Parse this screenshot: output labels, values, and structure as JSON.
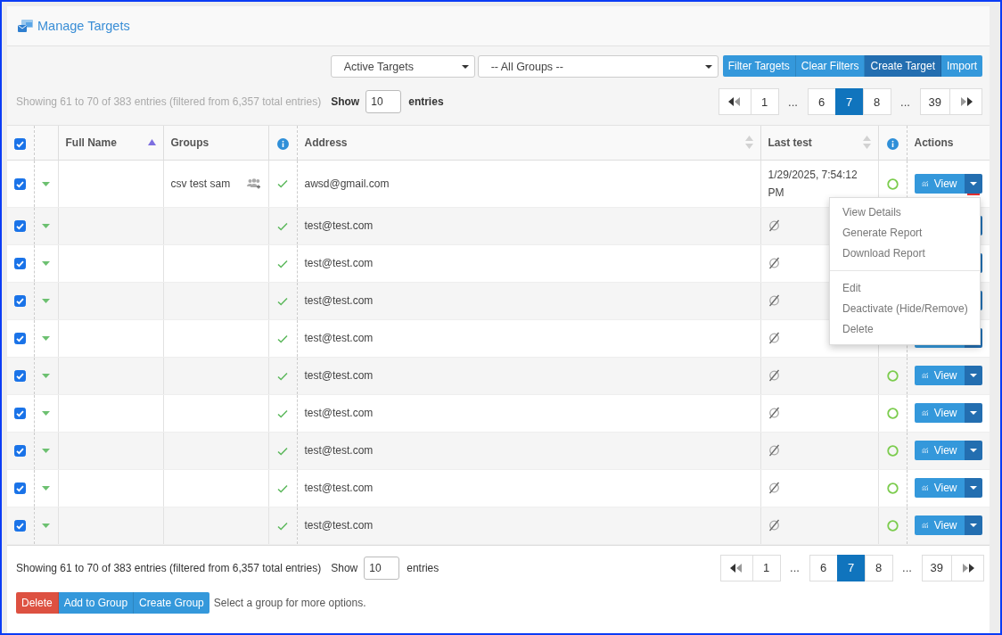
{
  "header": {
    "title": "Manage Targets"
  },
  "filters": {
    "status_select": "Active Targets",
    "group_select": "-- All Groups --",
    "buttons": [
      {
        "label": "Filter Targets",
        "kind": "primary"
      },
      {
        "label": "Clear Filters",
        "kind": "primary"
      },
      {
        "label": "Create Target",
        "kind": "dark"
      },
      {
        "label": "Import",
        "kind": "primary"
      }
    ]
  },
  "top_info": {
    "summary": "Showing 61 to 70 of 383 entries (filtered from 6,357 total entries)",
    "show_label": "Show",
    "page_size": "10",
    "entries_label": "entries"
  },
  "top_pagination": [
    {
      "kind": "first"
    },
    {
      "kind": "page",
      "label": "1",
      "selected": false
    },
    {
      "kind": "gap",
      "label": "..."
    },
    {
      "kind": "page",
      "label": "6",
      "selected": false
    },
    {
      "kind": "page",
      "label": "7",
      "selected": true
    },
    {
      "kind": "page",
      "label": "8",
      "selected": false
    },
    {
      "kind": "gap",
      "label": "..."
    },
    {
      "kind": "page",
      "label": "39",
      "selected": false
    },
    {
      "kind": "last"
    }
  ],
  "table": {
    "select_all_checked": true,
    "columns": [
      {
        "kind": "check"
      },
      {
        "kind": "expand"
      },
      {
        "kind": "text",
        "label": "Full Name",
        "sortable": true,
        "sorted": true
      },
      {
        "kind": "text",
        "label": "Groups",
        "sortable": false,
        "sorted": false
      },
      {
        "kind": "info"
      },
      {
        "kind": "text",
        "label": "Address",
        "sortable": true,
        "sorted": false
      },
      {
        "kind": "text",
        "label": "Last test",
        "sortable": true,
        "sorted": false
      },
      {
        "kind": "info"
      },
      {
        "kind": "text",
        "label": "Actions",
        "sortable": false,
        "sorted": false
      }
    ],
    "rows": [
      {
        "checked": true,
        "groups": "csv test sam",
        "address": "awsd@gmail.com",
        "last_test": "1/29/2025, 7:54:12 PM",
        "action": "View",
        "expanded": true
      },
      {
        "checked": true,
        "address": "test@test.com",
        "expanded": false
      },
      {
        "checked": true,
        "address": "test@test.com",
        "expanded": false
      },
      {
        "checked": true,
        "address": "test@test.com",
        "expanded": false
      },
      {
        "checked": true,
        "address": "test@test.com",
        "expanded": false
      },
      {
        "checked": true,
        "address": "test@test.com",
        "action": "View",
        "expanded": false
      },
      {
        "checked": true,
        "address": "test@test.com",
        "action": "View",
        "expanded": false
      },
      {
        "checked": true,
        "address": "test@test.com",
        "action": "View",
        "expanded": false
      },
      {
        "checked": true,
        "address": "test@test.com",
        "action": "View",
        "expanded": false
      },
      {
        "checked": true,
        "address": "test@test.com",
        "action": "View",
        "expanded": false
      }
    ]
  },
  "action_menu": [
    {
      "kind": "item",
      "label": "View Details"
    },
    {
      "kind": "item",
      "label": "Generate Report"
    },
    {
      "kind": "item",
      "label": "Download Report"
    },
    {
      "kind": "divider"
    },
    {
      "kind": "item",
      "label": "Edit"
    },
    {
      "kind": "item",
      "label": "Deactivate (Hide/Remove)"
    },
    {
      "kind": "item",
      "label": "Delete"
    }
  ],
  "bottom_info": {
    "summary": "Showing 61 to 70 of 383 entries (filtered from 6,357 total entries)",
    "show_label": "Show",
    "page_size": "10",
    "entries_label": "entries"
  },
  "bottom_pagination": [
    {
      "kind": "first"
    },
    {
      "kind": "page",
      "label": "1",
      "selected": false
    },
    {
      "kind": "gap",
      "label": "..."
    },
    {
      "kind": "page",
      "label": "6",
      "selected": false
    },
    {
      "kind": "page",
      "label": "7",
      "selected": true
    },
    {
      "kind": "page",
      "label": "8",
      "selected": false
    },
    {
      "kind": "gap",
      "label": "..."
    },
    {
      "kind": "page",
      "label": "39",
      "selected": false
    },
    {
      "kind": "last"
    }
  ],
  "bulk_actions": {
    "buttons": [
      {
        "label": "Delete",
        "kind": "danger"
      },
      {
        "label": "Add to Group",
        "kind": "primary"
      },
      {
        "label": "Create Group",
        "kind": "primary"
      }
    ],
    "hint": "Select a group for more options."
  }
}
